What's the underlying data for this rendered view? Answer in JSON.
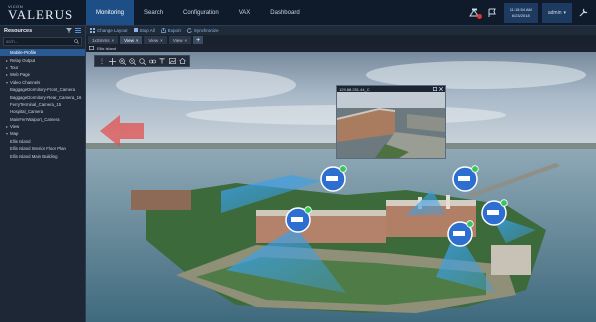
{
  "brand": {
    "vendor": "VICON",
    "name": "VALERUS"
  },
  "nav": [
    "Monitoring",
    "Search",
    "Configuration",
    "VAX",
    "Dashboard"
  ],
  "nav_active": 0,
  "header": {
    "time": "11:15:54 AM",
    "date": "6/23/2018",
    "user": "admin"
  },
  "sidebar": {
    "title": "Resources",
    "search_placeholder": "arch...",
    "items": [
      {
        "label": "Mobile-Profile",
        "toggle": ""
      },
      {
        "label": "Relay Output",
        "toggle": "▸"
      },
      {
        "label": "Tour",
        "toggle": "▸"
      },
      {
        "label": "Web Page",
        "toggle": "▸"
      },
      {
        "label": "Video Channels",
        "toggle": "▾"
      },
      {
        "label": "BaggageDormitory-Front_Camera",
        "toggle": ""
      },
      {
        "label": "BaggageDormitory-Rear_Camera_16",
        "toggle": ""
      },
      {
        "label": "FerryTerminal_Camera_15",
        "toggle": ""
      },
      {
        "label": "Hospital_Camera",
        "toggle": ""
      },
      {
        "label": "MainFerrWaiport_Camera",
        "toggle": ""
      },
      {
        "label": "View",
        "toggle": "▸"
      },
      {
        "label": "Map",
        "toggle": "▾"
      },
      {
        "label": "Ellis Island",
        "toggle": ""
      },
      {
        "label": "Ellis Island Interior Floor Plan",
        "toggle": ""
      },
      {
        "label": "Ellis Island Main Building",
        "toggle": ""
      }
    ],
    "selected_index": 0
  },
  "toolbar": {
    "items": [
      "Change Layout",
      "Stop All",
      "Export",
      "Synchronize"
    ]
  },
  "tabs": [
    {
      "label": "1xSmms",
      "close": "×"
    },
    {
      "label": "View",
      "close": "×"
    },
    {
      "label": "View",
      "close": "×"
    },
    {
      "label": "View",
      "close": "×"
    }
  ],
  "tabs_active": 1,
  "tab_add": "+",
  "map": {
    "title": "Ellis Island",
    "pip_title": "129.88.251.44_C"
  }
}
